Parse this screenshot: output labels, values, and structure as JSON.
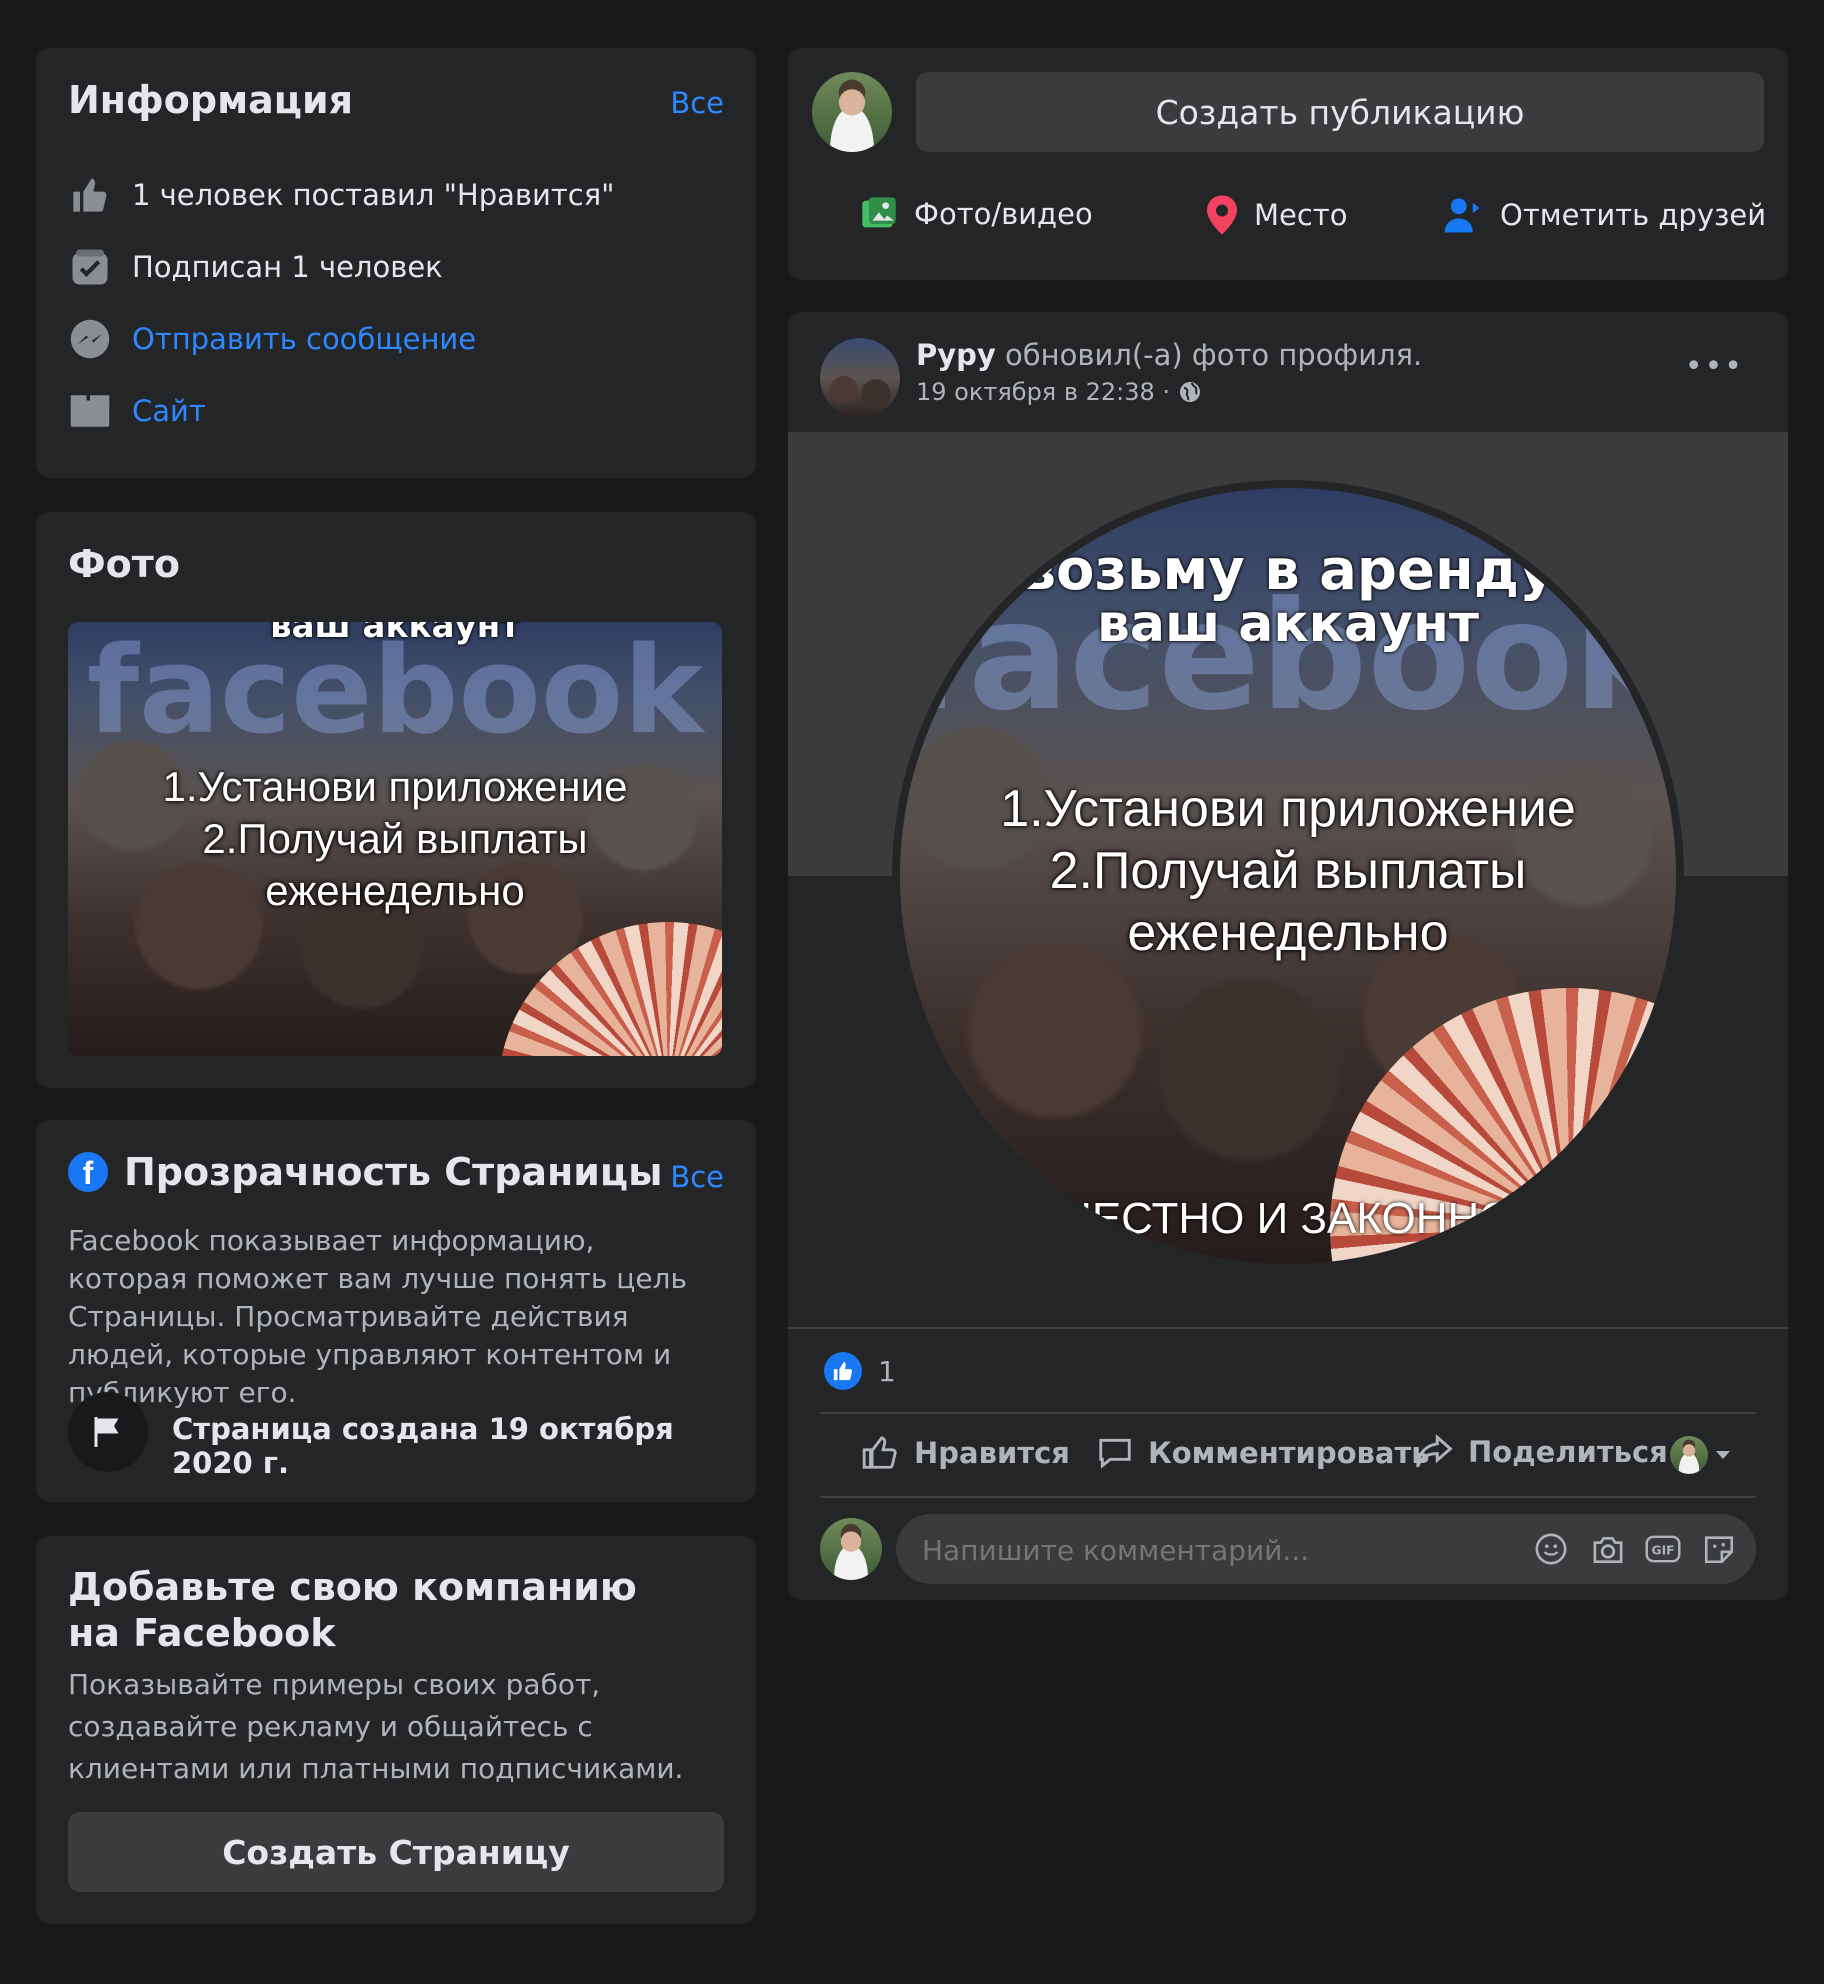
{
  "info": {
    "title": "Информация",
    "see_all": "Все",
    "likes": "1 человек поставил \"Нравится\"",
    "followers": "Подписан 1 человек",
    "message": "Отправить сообщение",
    "site": "Сайт"
  },
  "photos": {
    "title": "Фото"
  },
  "ad": {
    "brand_text": "facebook",
    "headline_line1": "возьму в аренду",
    "headline_line2": "ваш аккаунт",
    "line1": "1.Установи приложение",
    "line2": "2.Получай выплаты",
    "line3": "еженедельно",
    "footer": "ЧЕСТНО И ЗАКОННО"
  },
  "transparency": {
    "title": "Прозрачность Страницы",
    "see_all": "Все",
    "description": "Facebook показывает информацию, которая поможет вам лучше понять цель Страницы. Просматривайте действия людей, которые управляют контентом и публикуют его.",
    "created": "Страница создана 19 октября 2020 г."
  },
  "add_company": {
    "title": "Добавьте свою компанию на Facebook",
    "description": "Показывайте примеры своих работ, создавайте рекламу и общайтесь с клиентами или платными подписчиками.",
    "button": "Создать Страницу"
  },
  "composer": {
    "create_post": "Создать публикацию",
    "photo_video": "Фото/видео",
    "place": "Место",
    "tag_friends": "Отметить друзей"
  },
  "post": {
    "author": "Рypy",
    "action": "обновил(-а) фото профиля.",
    "timestamp": "19 октября в 22:38 ·",
    "likes_count": "1",
    "like": "Нравится",
    "comment": "Комментировать",
    "share": "Поделиться",
    "comment_placeholder": "Напишите комментарий..."
  },
  "colors": {
    "background": "#18191a",
    "card": "#242526",
    "button": "#3a3b3c",
    "link": "#2d88ff",
    "text": "#e4e6eb",
    "secondary_text": "#b0b3b8"
  }
}
